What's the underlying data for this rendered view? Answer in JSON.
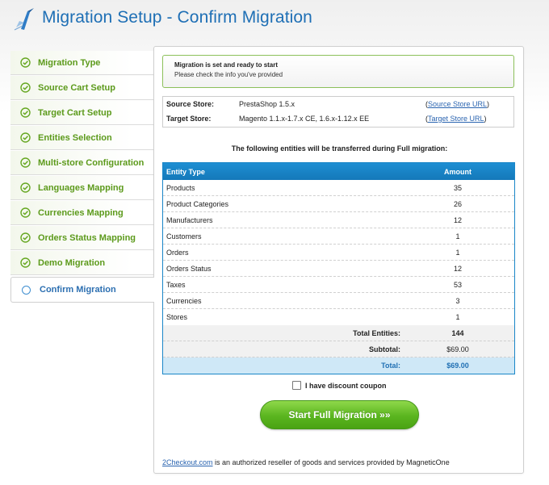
{
  "header": {
    "title": "Migration Setup - Confirm Migration"
  },
  "sidebar": {
    "steps": [
      {
        "label": "Migration Type",
        "state": "done"
      },
      {
        "label": "Source Cart Setup",
        "state": "done"
      },
      {
        "label": "Target Cart Setup",
        "state": "done"
      },
      {
        "label": "Entities Selection",
        "state": "done"
      },
      {
        "label": "Multi-store Configuration",
        "state": "done"
      },
      {
        "label": "Languages Mapping",
        "state": "done"
      },
      {
        "label": "Currencies Mapping",
        "state": "done"
      },
      {
        "label": "Orders Status Mapping",
        "state": "done"
      },
      {
        "label": "Demo Migration",
        "state": "done"
      },
      {
        "label": "Confirm Migration",
        "state": "current"
      }
    ]
  },
  "notice": {
    "title": "Migration is set and ready to start",
    "subtitle": "Please check the info you've provided"
  },
  "stores": {
    "source_label": "Source Store:",
    "source_value": "PrestaShop 1.5.x",
    "source_link": "Source Store URL",
    "target_label": "Target Store:",
    "target_value": "Magento 1.1.x-1.7.x CE, 1.6.x-1.12.x EE",
    "target_link": "Target Store URL"
  },
  "entities": {
    "intro": "The following entities will be transferred during Full migration:",
    "col_type": "Entity Type",
    "col_amount": "Amount",
    "rows": [
      {
        "name": "Products",
        "amount": "35"
      },
      {
        "name": "Product Categories",
        "amount": "26"
      },
      {
        "name": "Manufacturers",
        "amount": "12"
      },
      {
        "name": "Customers",
        "amount": "1"
      },
      {
        "name": "Orders",
        "amount": "1"
      },
      {
        "name": "Orders Status",
        "amount": "12"
      },
      {
        "name": "Taxes",
        "amount": "53"
      },
      {
        "name": "Currencies",
        "amount": "3"
      },
      {
        "name": "Stores",
        "amount": "1"
      }
    ],
    "total_entities_label": "Total Entities:",
    "total_entities_value": "144",
    "subtotal_label": "Subtotal:",
    "subtotal_value": "$69.00",
    "total_label": "Total:",
    "total_value": "$69.00"
  },
  "coupon": {
    "label": "I have discount coupon",
    "checked": false
  },
  "start_button": {
    "label": "Start Full Migration »»"
  },
  "footer": {
    "link": "2Checkout.com",
    "text": " is an authorized reseller of goods and services provided by MagneticOne"
  },
  "colors": {
    "title_blue": "#1e6fb5",
    "step_green": "#5c9a1b",
    "table_header_blue": "#1a86c8",
    "button_green": "#5ab51f"
  }
}
